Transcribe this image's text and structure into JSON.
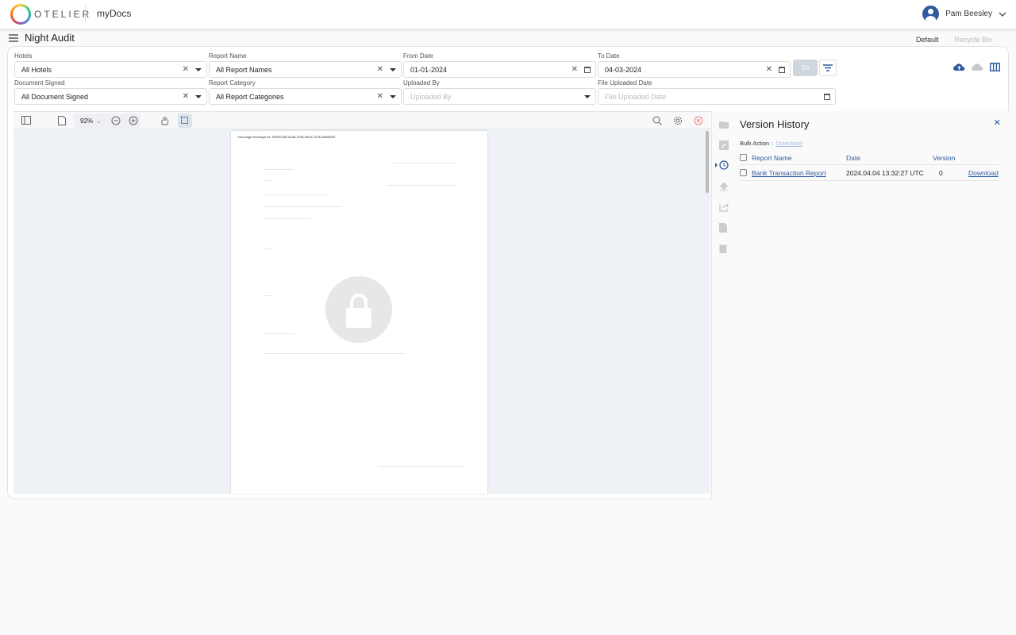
{
  "header": {
    "brand": "OTELIER",
    "app": "myDocs",
    "user": "Pam Beesley"
  },
  "page": {
    "title": "Night Audit",
    "tabs": [
      "Default",
      "Recycle Bin"
    ],
    "active_tab": "Default"
  },
  "filters": {
    "hotels": {
      "label": "Hotels",
      "value": "All Hotels"
    },
    "report_name": {
      "label": "Report Name",
      "value": "All Report Names"
    },
    "from_date": {
      "label": "From Date",
      "value": "01-01-2024"
    },
    "to_date": {
      "label": "To Date",
      "value": "04-03-2024"
    },
    "document_signed": {
      "label": "Document Signed",
      "value": "All Document Signed"
    },
    "report_category": {
      "label": "Report Category",
      "value": "All Report Categories"
    },
    "uploaded_by": {
      "label": "Uploaded By",
      "placeholder": "Uploaded By"
    },
    "file_uploaded_date": {
      "label": "File Uploaded Date",
      "placeholder": "File Uploaded Date"
    },
    "go": "Go"
  },
  "viewer": {
    "zoom": "92%",
    "envelope_id": "DocuSign Envelope ID: D9FB7238-A245-4738-9A01-127314AE55F0"
  },
  "version_history": {
    "title": "Version History",
    "bulk_label": "Bulk Action :",
    "bulk_download": "Download",
    "columns": [
      "Report Name",
      "Date",
      "Version"
    ],
    "rows": [
      {
        "name": "Bank Transaction Report",
        "date": "2024.04.04 13:32:27 UTC",
        "version": "0",
        "action": "Download"
      }
    ]
  },
  "colors": {
    "accent": "#2f5a9e",
    "tab_underline": "#f2c94c",
    "go_disabled": "#cfd6de"
  }
}
